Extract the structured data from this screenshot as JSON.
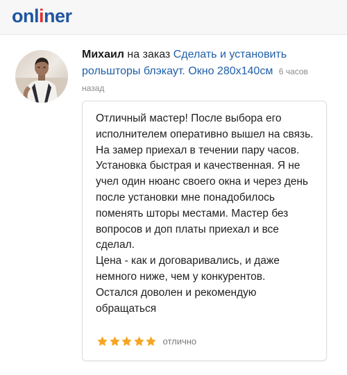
{
  "header": {
    "logo_part1": "onl",
    "logo_accent": "i",
    "logo_part2": "ner"
  },
  "review": {
    "author": "Михаил",
    "prefix": "на заказ",
    "order_title": "Сделать и установить рольшторы блэкаут. Окно 280x140см",
    "time_ago": "6 часов назад",
    "text": "Отличный мастер! После выбора его исполнителем оперативно вышел на связь. На замер приехал в течении пару часов. Установка быстрая и качественная. Я не учел один нюанс своего окна и через день после установки мне понадобилось поменять шторы местами. Мастер без вопросов и доп платы приехал и все сделал.\nЦена - как и договаривались, и даже немного ниже, чем у конкурентов.\nОстался доволен и рекомендую обращаться",
    "rating": 5,
    "rating_max": 5,
    "rating_label": "отлично"
  },
  "colors": {
    "brand_blue": "#1e56a0",
    "brand_red": "#e52d2d",
    "link": "#1e5fa8",
    "star": "#f5a623"
  },
  "icons": {
    "star": "star-icon",
    "avatar": "user-avatar"
  }
}
